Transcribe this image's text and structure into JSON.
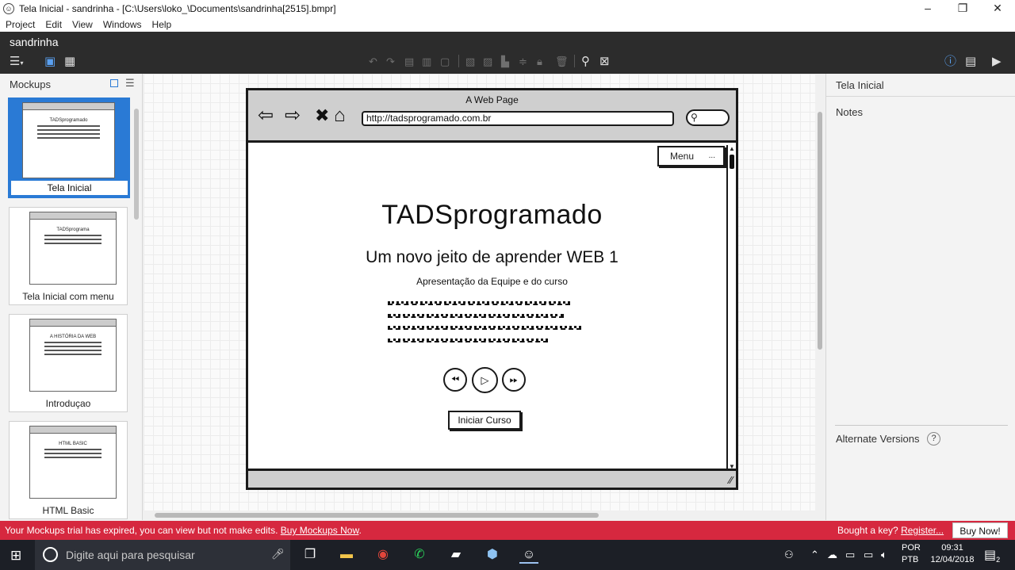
{
  "window": {
    "title": "Tela Inicial - sandrinha - [C:\\Users\\loko_\\Documents\\sandrinha[2515].bmpr]",
    "controls": [
      "–",
      "❐",
      "✕"
    ]
  },
  "menu": [
    "Project",
    "Edit",
    "View",
    "Windows",
    "Help"
  ],
  "app": {
    "project_name": "sandrinha"
  },
  "left_panel": {
    "title": "Mockups",
    "mockups": [
      {
        "label": "Tela Inicial",
        "thumb_title": "TADSprogramado"
      },
      {
        "label": "Tela Inicial com menu",
        "thumb_title": "TADSprograma"
      },
      {
        "label": "Introduçao",
        "thumb_title": "A HISTÓRIA DA WEB"
      },
      {
        "label": "HTML Basic",
        "thumb_title": "HTML BASIC"
      }
    ]
  },
  "mockup": {
    "page_title": "A Web Page",
    "url": "http://tadsprogramado.com.br",
    "menu_label": "Menu",
    "menu_dots": "...",
    "heading": "TADSprogramado",
    "subheading": "Um novo jeito de aprender WEB 1",
    "caption": "Apresentação da Equipe e do curso",
    "start_button": "Iniciar Curso"
  },
  "right_panel": {
    "title": "Tela Inicial",
    "notes_label": "Notes",
    "alt_versions_label": "Alternate Versions",
    "help": "?"
  },
  "banner": {
    "message": "Your Mockups trial has expired, you can view but not make edits.",
    "buy_link": "Buy Mockups Now",
    "key_question": "Bought a key?",
    "register_link": "Register...",
    "buy_now": "Buy Now!"
  },
  "taskbar": {
    "search_placeholder": "Digite aqui para pesquisar",
    "lang1": "POR",
    "lang2": "PTB",
    "time": "09:31",
    "date": "12/04/2018",
    "notifications": "2"
  }
}
